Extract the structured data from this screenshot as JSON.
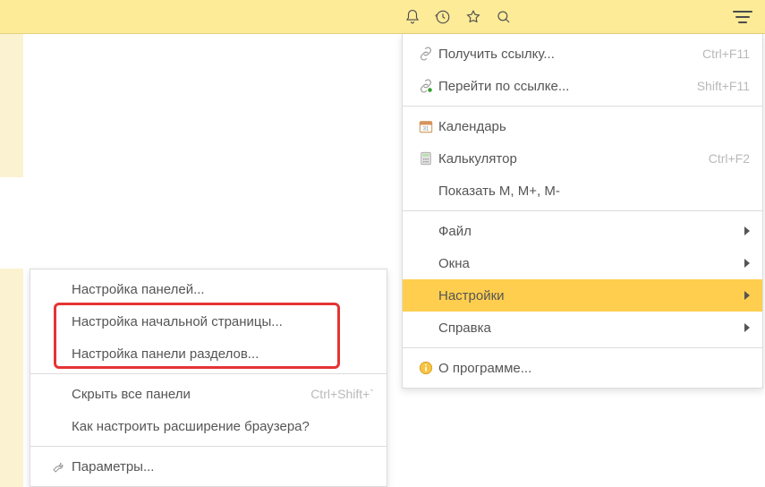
{
  "toolbar": {
    "icons": [
      "bell",
      "history",
      "star",
      "search",
      "hamburger"
    ]
  },
  "mainMenu": {
    "items": [
      {
        "label": "Получить ссылку...",
        "shortcut": "Ctrl+F11",
        "icon": "link"
      },
      {
        "label": "Перейти по ссылке...",
        "shortcut": "Shift+F11",
        "icon": "link-go"
      },
      {
        "sep": true
      },
      {
        "label": "Календарь",
        "icon": "calendar"
      },
      {
        "label": "Калькулятор",
        "icon": "calculator",
        "shortcut": "Ctrl+F2"
      },
      {
        "label": "Показать M, M+, M-"
      },
      {
        "sep": true
      },
      {
        "label": "Файл",
        "arrow": true
      },
      {
        "label": "Окна",
        "arrow": true
      },
      {
        "label": "Настройки",
        "arrow": true,
        "highlight": true
      },
      {
        "label": "Справка",
        "arrow": true
      },
      {
        "sep": true
      },
      {
        "label": "О программе...",
        "icon": "info"
      }
    ]
  },
  "subMenu": {
    "items": [
      {
        "label": "Настройка панелей..."
      },
      {
        "label": "Настройка начальной страницы..."
      },
      {
        "label": "Настройка панели разделов..."
      },
      {
        "sep": true
      },
      {
        "label": "Скрыть все панели",
        "shortcut": "Ctrl+Shift+`"
      },
      {
        "label": "Как настроить расширение браузера?"
      },
      {
        "sep": true
      },
      {
        "label": "Параметры...",
        "icon": "wrench"
      }
    ]
  }
}
